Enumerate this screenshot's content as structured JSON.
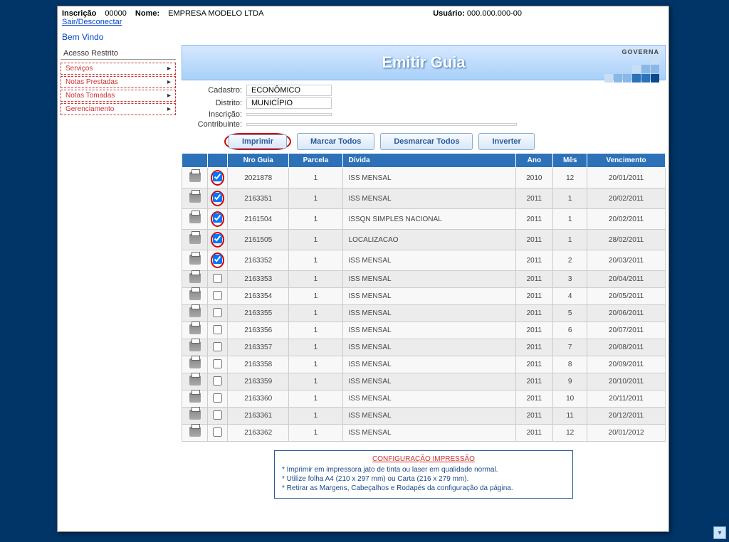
{
  "topbar": {
    "inscricao_label": "Inscrição",
    "inscricao_value": "00000",
    "nome_label": "Nome:",
    "nome_value": "EMPRESA MODELO LTDA",
    "usuario_label": "Usuário:",
    "usuario_value": "000.000.000-00",
    "sair_link": "Sair/Desconectar",
    "bemvindo": "Bem Vindo"
  },
  "sidebar": {
    "header": "Acesso Restrito",
    "items": [
      {
        "label": "Serviços"
      },
      {
        "label": "Notas Prestadas"
      },
      {
        "label": "Notas Tomadas"
      },
      {
        "label": "Gerenciamento"
      }
    ]
  },
  "banner": {
    "title": "Emitir Guia",
    "brand": "GOVERNA"
  },
  "info": {
    "cadastro_label": "Cadastro:",
    "cadastro_value": "ECONÔMICO",
    "distrito_label": "Distrito:",
    "distrito_value": "MUNICÍPIO",
    "inscricao_label": "Inscrição:",
    "inscricao_value": "",
    "contribuinte_label": "Contribuinte:",
    "contribuinte_value": ""
  },
  "toolbar": {
    "imprimir": "Imprimir",
    "marcar_todos": "Marcar Todos",
    "desmarcar_todos": "Desmarcar Todos",
    "inverter": "Inverter"
  },
  "table": {
    "headers": {
      "nro_guia": "Nro Guia",
      "parcela": "Parcela",
      "divida": "Dívida",
      "ano": "Ano",
      "mes": "Mês",
      "vencimento": "Vencimento"
    },
    "rows": [
      {
        "checked": true,
        "circled": true,
        "nro": "2021878",
        "parc": "1",
        "div": "ISS MENSAL",
        "ano": "2010",
        "mes": "12",
        "venc": "20/01/2011"
      },
      {
        "checked": true,
        "circled": true,
        "nro": "2163351",
        "parc": "1",
        "div": "ISS MENSAL",
        "ano": "2011",
        "mes": "1",
        "venc": "20/02/2011"
      },
      {
        "checked": true,
        "circled": true,
        "nro": "2161504",
        "parc": "1",
        "div": "ISSQN SIMPLES NACIONAL",
        "ano": "2011",
        "mes": "1",
        "venc": "20/02/2011"
      },
      {
        "checked": true,
        "circled": true,
        "nro": "2161505",
        "parc": "1",
        "div": "LOCALIZACAO",
        "ano": "2011",
        "mes": "1",
        "venc": "28/02/2011"
      },
      {
        "checked": true,
        "circled": true,
        "nro": "2163352",
        "parc": "1",
        "div": "ISS MENSAL",
        "ano": "2011",
        "mes": "2",
        "venc": "20/03/2011"
      },
      {
        "checked": false,
        "circled": false,
        "nro": "2163353",
        "parc": "1",
        "div": "ISS MENSAL",
        "ano": "2011",
        "mes": "3",
        "venc": "20/04/2011"
      },
      {
        "checked": false,
        "circled": false,
        "nro": "2163354",
        "parc": "1",
        "div": "ISS MENSAL",
        "ano": "2011",
        "mes": "4",
        "venc": "20/05/2011"
      },
      {
        "checked": false,
        "circled": false,
        "nro": "2163355",
        "parc": "1",
        "div": "ISS MENSAL",
        "ano": "2011",
        "mes": "5",
        "venc": "20/06/2011"
      },
      {
        "checked": false,
        "circled": false,
        "nro": "2163356",
        "parc": "1",
        "div": "ISS MENSAL",
        "ano": "2011",
        "mes": "6",
        "venc": "20/07/2011"
      },
      {
        "checked": false,
        "circled": false,
        "nro": "2163357",
        "parc": "1",
        "div": "ISS MENSAL",
        "ano": "2011",
        "mes": "7",
        "venc": "20/08/2011"
      },
      {
        "checked": false,
        "circled": false,
        "nro": "2163358",
        "parc": "1",
        "div": "ISS MENSAL",
        "ano": "2011",
        "mes": "8",
        "venc": "20/09/2011"
      },
      {
        "checked": false,
        "circled": false,
        "nro": "2163359",
        "parc": "1",
        "div": "ISS MENSAL",
        "ano": "2011",
        "mes": "9",
        "venc": "20/10/2011"
      },
      {
        "checked": false,
        "circled": false,
        "nro": "2163360",
        "parc": "1",
        "div": "ISS MENSAL",
        "ano": "2011",
        "mes": "10",
        "venc": "20/11/2011"
      },
      {
        "checked": false,
        "circled": false,
        "nro": "2163361",
        "parc": "1",
        "div": "ISS MENSAL",
        "ano": "2011",
        "mes": "11",
        "venc": "20/12/2011"
      },
      {
        "checked": false,
        "circled": false,
        "nro": "2163362",
        "parc": "1",
        "div": "ISS MENSAL",
        "ano": "2011",
        "mes": "12",
        "venc": "20/01/2012"
      }
    ]
  },
  "config": {
    "title": "CONFIGURAÇÃO IMPRESSÃO",
    "l1": "* Imprimir em impressora jato de tinta ou laser em qualidade normal.",
    "l2": "* Utilize folha A4 (210 x 297 mm) ou Carta (216 x 279 mm).",
    "l3": "* Retirar as Margens, Cabeçalhos e Rodapés da configuração da página."
  }
}
